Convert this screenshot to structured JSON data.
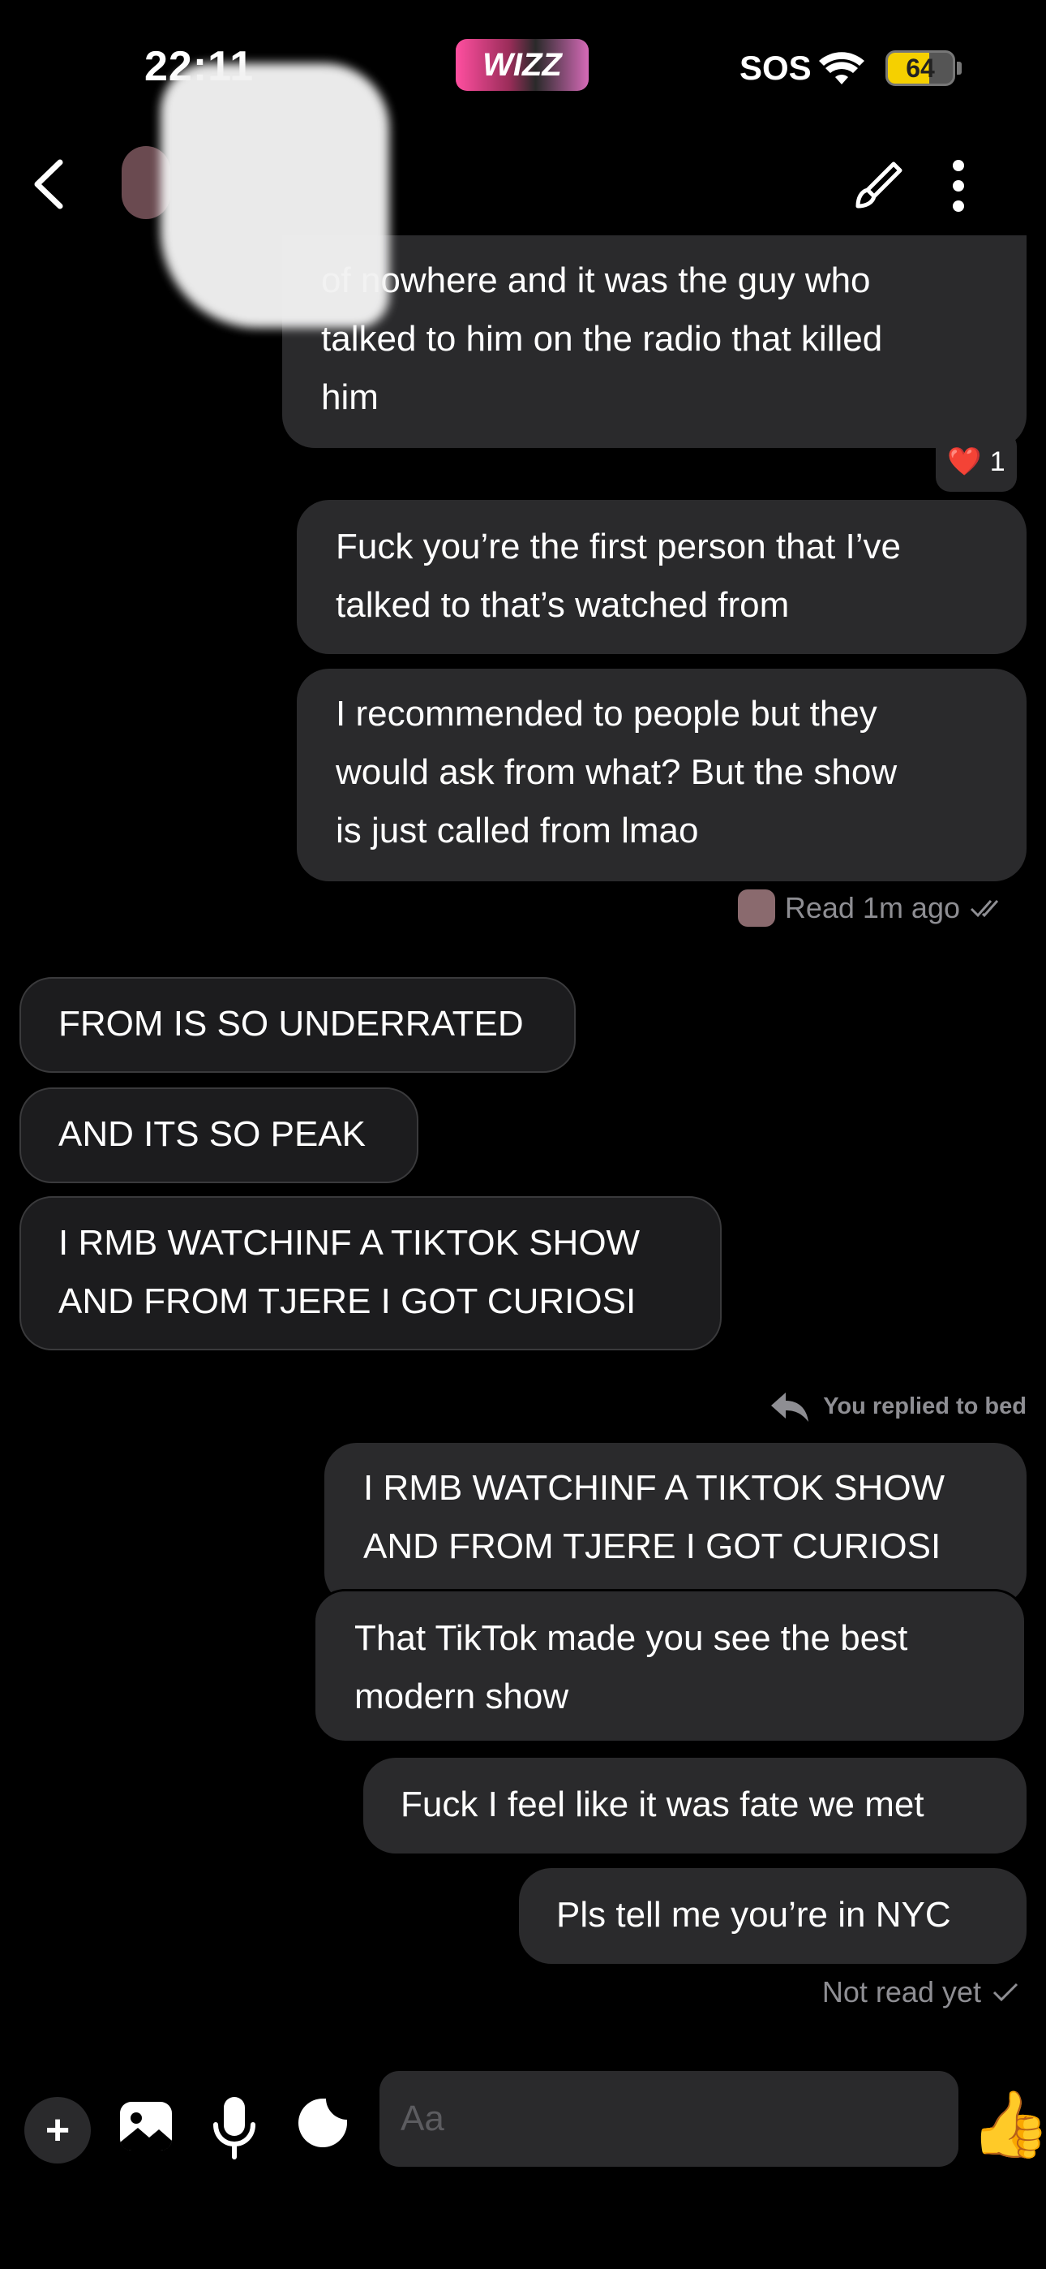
{
  "status_bar": {
    "time": "22:11",
    "app_badge": "WIZZ",
    "carrier": "SOS",
    "battery": "64",
    "battery_percent": 64
  },
  "header": {
    "back_icon": "chevron-left-icon",
    "edit_icon": "brush-icon",
    "more_icon": "more-vertical-icon"
  },
  "messages": {
    "m1": [
      "of nowhere and it was the guy who",
      "talked to him on the radio that killed",
      "him"
    ],
    "reaction": {
      "emoji": "❤️",
      "count": "1"
    },
    "m2": [
      "Fuck you’re the first person that I’ve",
      "talked to that’s watched from"
    ],
    "m3": [
      "I recommended to people but they",
      "would ask from what? But the show",
      "is just called from lmao"
    ],
    "read_status": "Read 1m ago",
    "m4": "FROM IS SO UNDERRATED",
    "m5": "AND ITS SO PEAK",
    "m6": [
      "I RMB WATCHINF A TIKTOK SHOW",
      "AND FROM TJERE I GOT CURIOSI"
    ],
    "reply_label": "You replied to bed",
    "quoted": [
      "I RMB WATCHINF A TIKTOK SHOW",
      "AND FROM TJERE I GOT CURIOSI"
    ],
    "m7": [
      "That TikTok made you see the best",
      "modern show"
    ],
    "m8": "Fuck I feel like it was fate we met",
    "m9": "Pls tell me you’re in NYC",
    "not_read_status": "Not read yet"
  },
  "composer": {
    "placeholder": "Aa",
    "plus_label": "+",
    "like_emoji": "👍"
  },
  "colors": {
    "background": "#000000",
    "outgoing_bubble": "#2a2a2c",
    "incoming_bubble": "#1c1c1e",
    "muted_text": "#8e8e93",
    "heart": "#e0303c"
  }
}
